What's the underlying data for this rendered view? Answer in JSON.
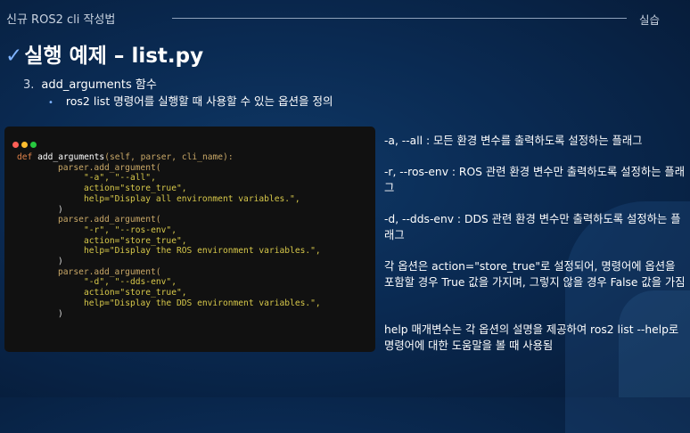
{
  "header": {
    "left": "신규 ROS2 cli 작성법",
    "right": "실습"
  },
  "title": {
    "check": "✓",
    "text": "실행 예제 – list.py"
  },
  "list": {
    "number": "3.",
    "main": "add_arguments 함수",
    "bullet": "•",
    "sub": "ros2 list 명령어를 실행할 때 사용할 수 있는 옵션을 정의"
  },
  "window_dots": [
    "#ff5f56",
    "#ffbd2e",
    "#27c93f"
  ],
  "code": {
    "def_kw": "def",
    "func_name": "add_arguments",
    "params": "(self, parser, cli_name):",
    "blocks": [
      {
        "call": "parser.add_argument(",
        "flags": "\"-a\", \"--all\",",
        "action": "action=\"store_true\",",
        "help": "help=\"Display all environment variables.\",",
        "close": ")"
      },
      {
        "call": "parser.add_argument(",
        "flags": "\"-r\", \"--ros-env\",",
        "action": "action=\"store_true\",",
        "help": "help=\"Display the ROS environment variables.\",",
        "close": ")"
      },
      {
        "call": "parser.add_argument(",
        "flags": "\"-d\", \"--dds-env\",",
        "action": "action=\"store_true\",",
        "help": "help=\"Display the DDS environment variables.\",",
        "close": ")"
      }
    ]
  },
  "descriptions": [
    "-a, --all : 모든 환경 변수를 출력하도록 설정하는 플래그",
    "-r, --ros-env : ROS 관련 환경 변수만 출력하도록 설정하는 플래그",
    "-d, --dds-env : DDS 관련 환경 변수만 출력하도록 설정하는 플래그",
    "각 옵션은 action=\"store_true\"로 설정되어, 명령어에 옵션을 포함할 경우 True 값을 가지며, 그렇지 않을 경우 False 값을 가짐",
    "help 매개변수는 각 옵션의 설명을 제공하여 ros2 list --help로 명령어에 대한 도움말을 볼 때 사용됨"
  ]
}
